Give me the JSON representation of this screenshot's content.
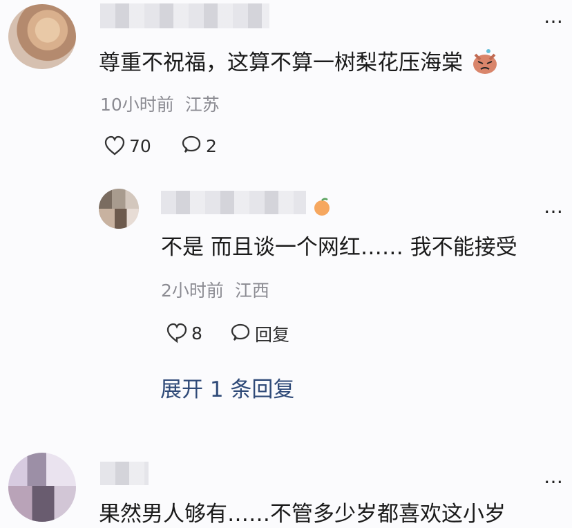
{
  "colors": {
    "background": "#fbfbfd",
    "meta": "#8b8b92",
    "link": "#2f4a78",
    "text": "#1a1a1a"
  },
  "comments": [
    {
      "text": "尊重不祝福，这算不算一树梨花压海棠",
      "time": "10小时前",
      "location": "江苏",
      "likes": "70",
      "replies_count": "2"
    },
    {
      "text": "不是 而且谈一个网红…… 我不能接受",
      "time": "2小时前",
      "location": "江西",
      "likes": "8",
      "reply_label": "回复",
      "expand_label": "展开 1 条回复"
    },
    {
      "text": "果然男人够有……不管多少岁都喜欢这小岁"
    }
  ],
  "icons": {
    "more": "more-dots-icon",
    "like": "heart-outline-icon",
    "reply": "chat-bubble-icon",
    "emoji": "angry-face-emoji-icon",
    "badge": "orange-badge-icon"
  }
}
